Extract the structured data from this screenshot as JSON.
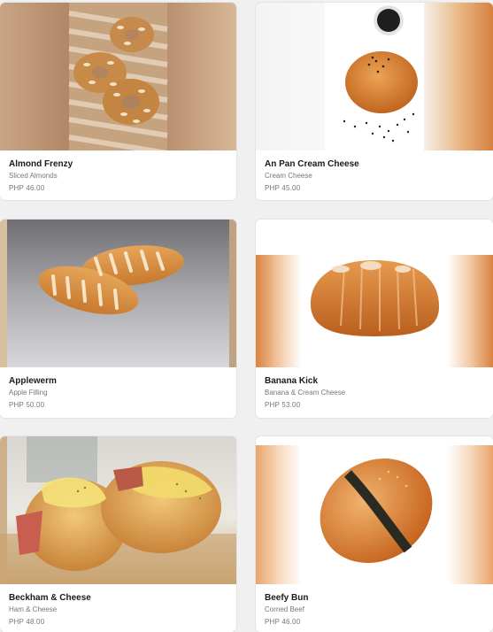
{
  "products": [
    {
      "name": "Almond Frenzy",
      "description": "Sliced Almonds",
      "price": "PHP 46.00"
    },
    {
      "name": "An Pan Cream Cheese",
      "description": "Cream Cheese",
      "price": "PHP 45.00"
    },
    {
      "name": "Applewerm",
      "description": "Apple Filling",
      "price": "PHP 50.00"
    },
    {
      "name": "Banana Kick",
      "description": "Banana & Cream Cheese",
      "price": "PHP 53.00"
    },
    {
      "name": "Beckham & Cheese",
      "description": "Ham & Cheese",
      "price": "PHP 48.00"
    },
    {
      "name": "Beefy Bun",
      "description": "Corned Beef",
      "price": "PHP 46.00"
    }
  ]
}
